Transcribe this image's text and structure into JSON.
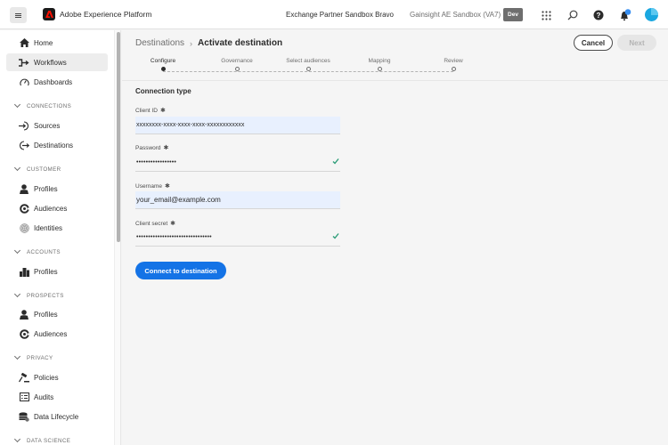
{
  "topbar": {
    "app_title": "Adobe Experience Platform",
    "org_name": "Exchange Partner Sandbox Bravo",
    "sandbox_name": "Gainsight AE Sandbox (VA7)",
    "env_badge": "Dev",
    "icons": [
      "menu-icon",
      "adobe-logo",
      "apps-grid-icon",
      "search-icon",
      "help-icon",
      "notification-bell-icon",
      "user-avatar"
    ],
    "accent_color": "#1473e6"
  },
  "sidebar": {
    "items": [
      {
        "label": "Home",
        "icon": "home-icon"
      },
      {
        "label": "Workflows",
        "icon": "workflows-icon",
        "active": true
      },
      {
        "label": "Dashboards",
        "icon": "dashboard-icon"
      }
    ],
    "sections": [
      {
        "title": "CONNECTIONS",
        "items": [
          {
            "label": "Sources",
            "icon": "sources-icon"
          },
          {
            "label": "Destinations",
            "icon": "destinations-icon"
          }
        ]
      },
      {
        "title": "CUSTOMER",
        "items": [
          {
            "label": "Profiles",
            "icon": "profile-icon"
          },
          {
            "label": "Audiences",
            "icon": "audiences-icon"
          },
          {
            "label": "Identities",
            "icon": "fingerprint-icon"
          }
        ]
      },
      {
        "title": "ACCOUNTS",
        "items": [
          {
            "label": "Profiles",
            "icon": "building-icon"
          }
        ]
      },
      {
        "title": "PROSPECTS",
        "items": [
          {
            "label": "Profiles",
            "icon": "profile-icon"
          },
          {
            "label": "Audiences",
            "icon": "audiences-icon"
          }
        ]
      },
      {
        "title": "PRIVACY",
        "items": [
          {
            "label": "Policies",
            "icon": "gavel-icon"
          },
          {
            "label": "Audits",
            "icon": "audit-list-icon"
          },
          {
            "label": "Data Lifecycle",
            "icon": "database-icon"
          }
        ]
      },
      {
        "title": "DATA SCIENCE",
        "items": []
      }
    ]
  },
  "main": {
    "breadcrumb": {
      "parent": "Destinations",
      "separator": "›",
      "current": "Activate destination"
    },
    "buttons": {
      "cancel": "Cancel",
      "next": "Next"
    },
    "stepper": {
      "steps": [
        "Configure",
        "Governance",
        "Select audiences",
        "Mapping",
        "Review"
      ],
      "active_index": 0
    },
    "form": {
      "section_title": "Connection type",
      "required_marker": "✱",
      "fields": [
        {
          "label": "Client ID",
          "value": "xxxxxxxx-xxxx-xxxx-xxxx-xxxxxxxxxxxx",
          "type": "text",
          "valid": false
        },
        {
          "label": "Password",
          "value": "•••••••••••••••••",
          "type": "password",
          "valid": true
        },
        {
          "label": "Username",
          "value": "your_email@example.com",
          "type": "text",
          "valid": false
        },
        {
          "label": "Client secret",
          "value": "••••••••••••••••••••••••••••••••",
          "type": "password",
          "valid": true
        }
      ],
      "submit_label": "Connect to destination"
    }
  }
}
